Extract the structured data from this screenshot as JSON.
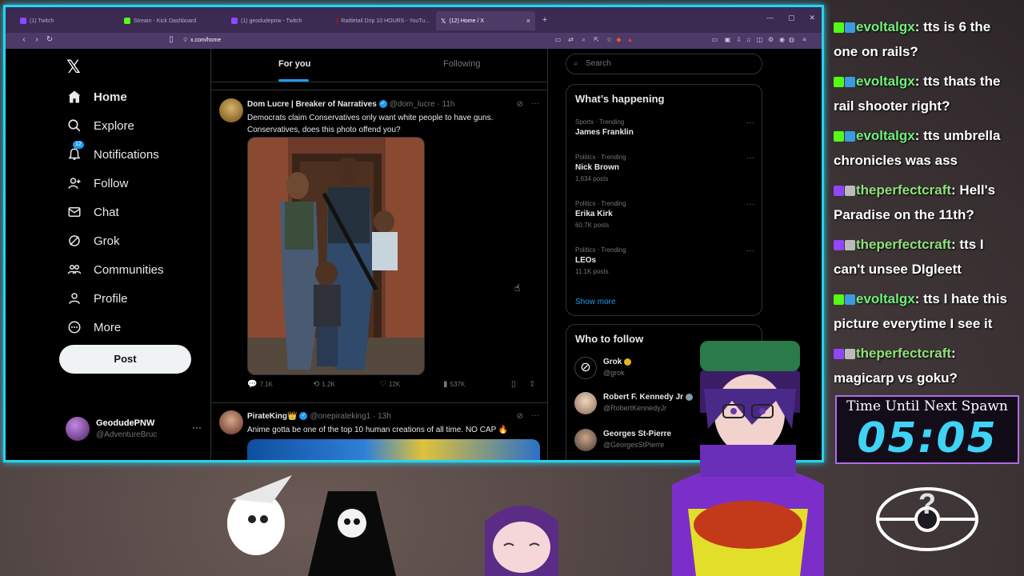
{
  "browser": {
    "tabs": [
      {
        "label": "(1) Twitch",
        "color": "#9146ff"
      },
      {
        "label": "Stream - Kick Dashboard",
        "color": "#53fc18"
      },
      {
        "label": "(1) geodudepnw - Twitch",
        "color": "#9146ff"
      },
      {
        "label": "Rattletail Drip 10 HOURS - YouTu...",
        "color": "#ff0000"
      },
      {
        "label": "(12) Home / X",
        "color": "#ffffff"
      }
    ],
    "url": "x.com/home"
  },
  "nav": {
    "items": [
      {
        "label": "Home",
        "icon": "home-icon",
        "glyph": "⌂"
      },
      {
        "label": "Explore",
        "icon": "search-icon",
        "glyph": "⌕"
      },
      {
        "label": "Notifications",
        "icon": "bell-icon",
        "glyph": "🔔",
        "badge": "12"
      },
      {
        "label": "Follow",
        "icon": "person-add-icon",
        "glyph": "👤"
      },
      {
        "label": "Chat",
        "icon": "envelope-icon",
        "glyph": "✉"
      },
      {
        "label": "Grok",
        "icon": "grok-icon",
        "glyph": "⊘"
      },
      {
        "label": "Communities",
        "icon": "people-icon",
        "glyph": "👥"
      },
      {
        "label": "Profile",
        "icon": "person-icon",
        "glyph": "👤"
      },
      {
        "label": "More",
        "icon": "more-circle-icon",
        "glyph": "⋯"
      }
    ],
    "post_label": "Post",
    "account": {
      "name": "GeodudePNW",
      "handle": "@AdventureBruc"
    }
  },
  "feed": {
    "tabs": [
      "For you",
      "Following"
    ],
    "tweets": [
      {
        "name": "Dom Lucre | Breaker of Narratives",
        "handle": "@dom_lucre · 11h",
        "text": "Democrats claim Conservatives only want white people to have guns. Conservatives, does this photo offend you?",
        "replies": "7.1K",
        "reposts": "1.2K",
        "likes": "12K",
        "views": "537K"
      },
      {
        "name": "PirateKing👑",
        "handle": "@onepirateking1 · 13h",
        "text": "Anime gotta be one of the top 10 human creations of all time. NO CAP 🔥"
      }
    ]
  },
  "sidebar": {
    "search_placeholder": "Search",
    "happening_title": "What’s happening",
    "trends": [
      {
        "category": "Sports · Trending",
        "name": "James Franklin",
        "posts": ""
      },
      {
        "category": "Politics · Trending",
        "name": "Nick Brown",
        "posts": "1,634 posts"
      },
      {
        "category": "Politics · Trending",
        "name": "Erika Kirk",
        "posts": "60.7K posts"
      },
      {
        "category": "Politics · Trending",
        "name": "LEOs",
        "posts": "11.1K posts"
      }
    ],
    "show_more": "Show more",
    "follow_title": "Who to follow",
    "follow": [
      {
        "name": "Grok",
        "handle": "@grok"
      },
      {
        "name": "Robert F. Kennedy Jr",
        "handle": "@RobertKennedyJr"
      },
      {
        "name": "Georges St-Pierre",
        "handle": "@GeorgesStPierre"
      }
    ]
  },
  "chat": {
    "messages": [
      {
        "user": "evoltalgx",
        "text": ": tts is 6 the one on rails?",
        "platform": "kick"
      },
      {
        "user": "evoltalgx",
        "text": ": tts thats the rail shooter right?",
        "platform": "kick"
      },
      {
        "user": "evoltalgx",
        "text": ": tts umbrella chronicles was ass",
        "platform": "kick"
      },
      {
        "user": "theperfectcraft",
        "text": ": Hell's Paradise on the 11th?",
        "platform": "twitch"
      },
      {
        "user": "theperfectcraft",
        "text": ": tts I can't unsee DIgleett",
        "platform": "twitch"
      },
      {
        "user": "evoltalgx",
        "text": ": tts I hate this picture everytime I see it",
        "platform": "kick"
      },
      {
        "user": "theperfectcraft",
        "text": ": magicarp vs goku?",
        "platform": "twitch"
      }
    ]
  },
  "timer": {
    "title": "Time Until Next Spawn",
    "value": "05:05"
  }
}
